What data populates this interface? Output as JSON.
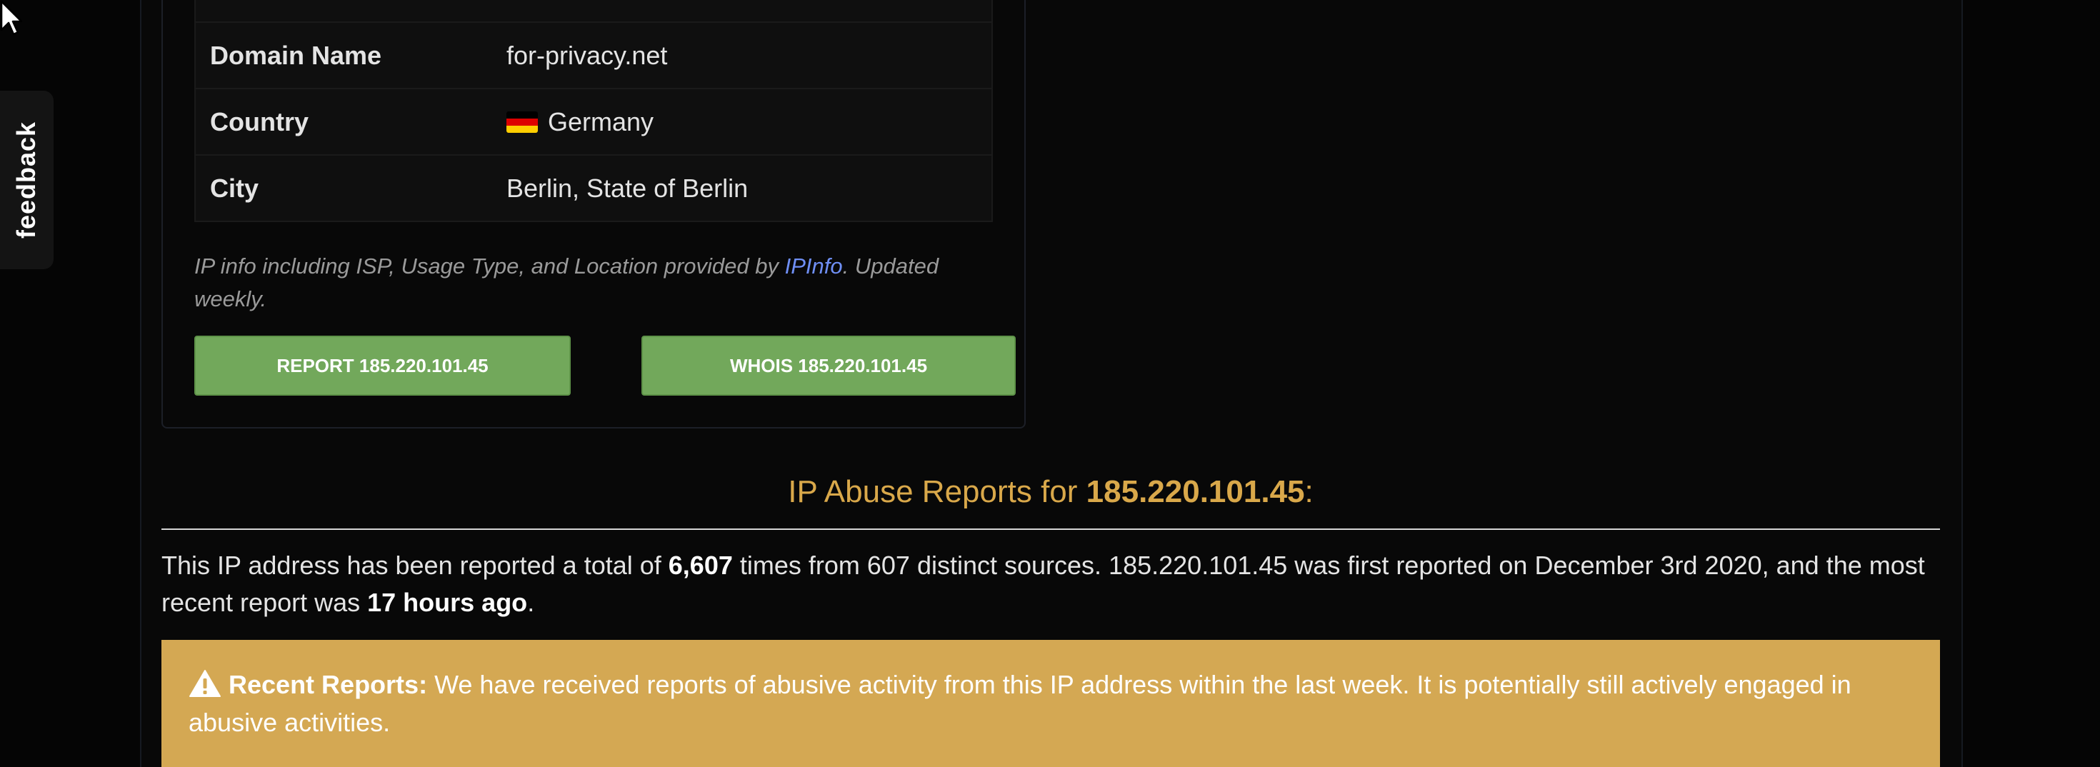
{
  "feedback": {
    "label": "feedback"
  },
  "ip_info": {
    "rows": [
      {
        "key": "",
        "value": ""
      },
      {
        "key": "Domain Name",
        "value": "for-privacy.net"
      },
      {
        "key": "Country",
        "value": "Germany",
        "icon": "germany-flag-icon"
      },
      {
        "key": "City",
        "value": "Berlin, State of Berlin"
      }
    ],
    "note_before": "IP info including ISP, Usage Type, and Location provided by ",
    "note_link": "IPInfo",
    "note_after": ". Updated weekly."
  },
  "buttons": {
    "report": "REPORT 185.220.101.45",
    "whois": "WHOIS 185.220.101.45"
  },
  "reports": {
    "heading_prefix": "IP Abuse Reports for ",
    "heading_ip": "185.220.101.45",
    "heading_suffix": ":",
    "summary_1": "This IP address has been reported a total of ",
    "total_reports": "6,607",
    "summary_2": " times from 607 distinct sources. 185.220.101.45 was first reported on December 3rd 2020, and the most recent report was ",
    "last_report": "17 hours ago",
    "summary_3": "."
  },
  "alert": {
    "icon": "warning-icon",
    "title": "Recent Reports:",
    "message": " We have received reports of abusive activity from this IP address within the last week. It is potentially still actively engaged in abusive activities."
  },
  "colors": {
    "accent_heading": "#d9a84a",
    "button_green": "#72a85b",
    "alert_bg": "#d4a853",
    "link_blue": "#6f8ff5"
  }
}
